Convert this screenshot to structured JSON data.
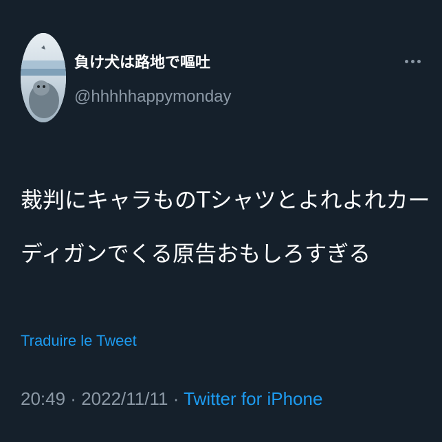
{
  "author": {
    "display_name": "負け犬は路地で嘔吐",
    "handle": "@hhhhhappymonday"
  },
  "more_icon": "more-horizontal-icon",
  "tweet": {
    "text_line_1": "裁判にキャラものTシャツとよれよれカー",
    "text_line_2": "ディガンでくる原告おもしろすぎる"
  },
  "translate_label": "Traduire le Tweet",
  "meta": {
    "time": "20:49",
    "separator_1": " · ",
    "date": "2022/11/11",
    "separator_2": " · ",
    "source": "Twitter for iPhone"
  },
  "colors": {
    "background": "#15202b",
    "text": "#ffffff",
    "secondary": "#8b98a5",
    "accent": "#1d9bf0"
  }
}
